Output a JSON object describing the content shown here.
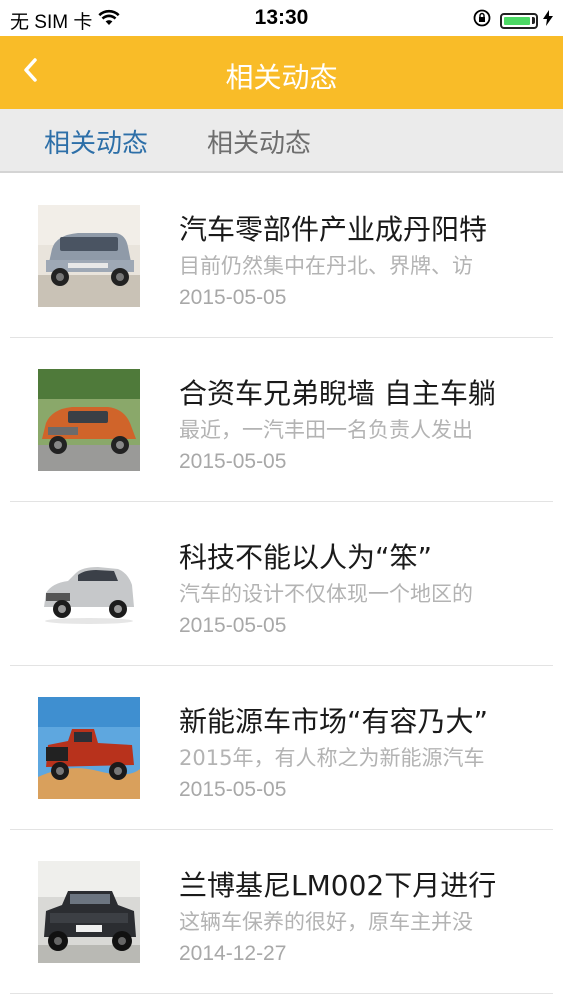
{
  "status_bar": {
    "carrier": "无 SIM 卡",
    "time": "13:30",
    "battery_level": 0.85
  },
  "nav": {
    "title": "相关动态",
    "back_icon": "chevron-left-icon"
  },
  "tabs": [
    {
      "label": "相关动态",
      "active": true
    },
    {
      "label": "相关动态",
      "active": false
    }
  ],
  "colors": {
    "nav_bg": "#f9bc28",
    "tab_active": "#2d6fa8",
    "tab_inactive": "#6e6e6e"
  },
  "articles": [
    {
      "title": "汽车零部件产业成丹阳特",
      "summary": "目前仍然集中在丹北、界牌、访",
      "date": "2015-05-05",
      "image": "silver-suv-photo"
    },
    {
      "title": "合资车兄弟睨墙 自主车躺",
      "summary": "最近，一汽丰田一名负责人发出",
      "date": "2015-05-05",
      "image": "orange-crossover-photo"
    },
    {
      "title": "科技不能以人为“笨”",
      "summary": "汽车的设计不仅体现一个地区的",
      "date": "2015-05-05",
      "image": "white-suv-photo"
    },
    {
      "title": "新能源车市场“有容乃大”",
      "summary": "2015年，有人称之为新能源汽车",
      "date": "2015-05-05",
      "image": "red-pickup-photo"
    },
    {
      "title": "兰博基尼LM002下月进行",
      "summary": "这辆车保养的很好，原车主并没",
      "date": "2014-12-27",
      "image": "black-offroader-photo"
    }
  ]
}
